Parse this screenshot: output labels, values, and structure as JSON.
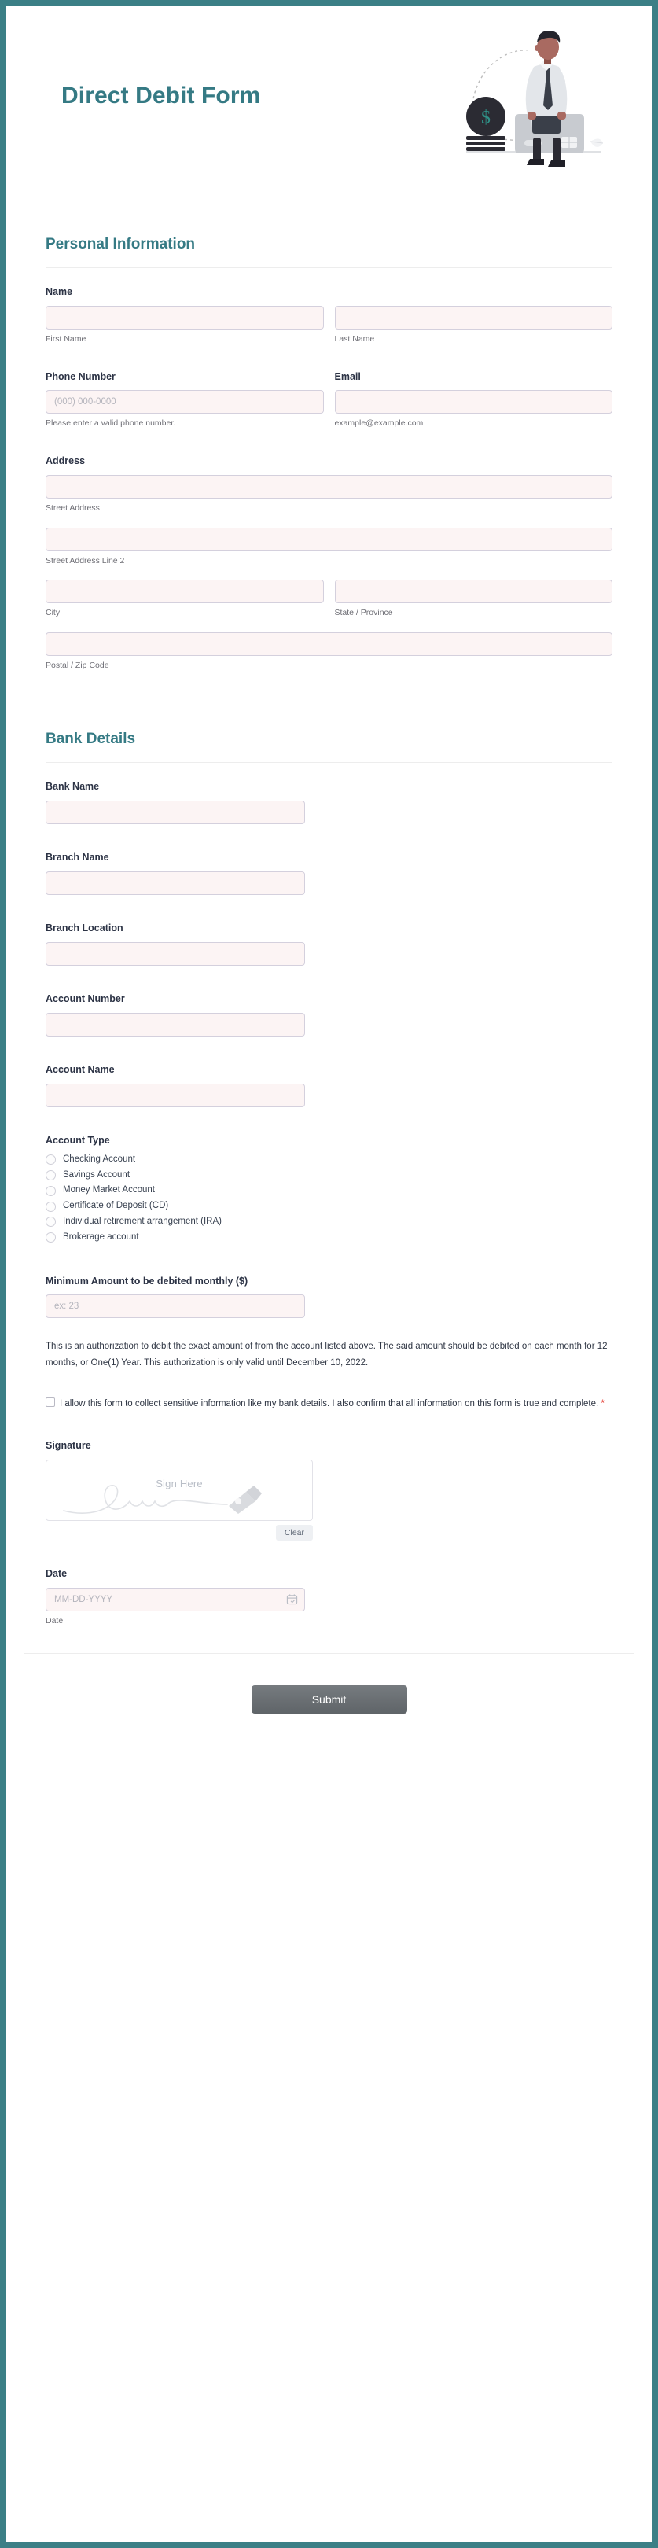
{
  "page": {
    "border_color": "#3b7f86",
    "accent_color": "#357a84",
    "input_bg": "#fcf4f4",
    "required_color": "#e1251b"
  },
  "header": {
    "title": "Direct Debit Form",
    "illustration": "person-with-credit-card-and-coins-illustration"
  },
  "personal": {
    "section_title": "Personal Information",
    "name": {
      "label": "Name",
      "first": {
        "value": "",
        "placeholder": "",
        "sub": "First Name"
      },
      "last": {
        "value": "",
        "placeholder": "",
        "sub": "Last Name"
      }
    },
    "phone": {
      "label": "Phone Number",
      "placeholder": "(000) 000-0000",
      "value": "",
      "sub": "Please enter a valid phone number."
    },
    "email": {
      "label": "Email",
      "placeholder": "",
      "value": "",
      "sub": "example@example.com"
    },
    "address": {
      "label": "Address",
      "street1": {
        "value": "",
        "sub": "Street Address"
      },
      "street2": {
        "value": "",
        "sub": "Street Address Line 2"
      },
      "city": {
        "value": "",
        "sub": "City"
      },
      "state": {
        "value": "",
        "sub": "State / Province"
      },
      "zip": {
        "value": "",
        "sub": "Postal / Zip Code"
      }
    }
  },
  "bank": {
    "section_title": "Bank Details",
    "bank_name": {
      "label": "Bank Name",
      "value": ""
    },
    "branch_name": {
      "label": "Branch Name",
      "value": ""
    },
    "branch_location": {
      "label": "Branch Location",
      "value": ""
    },
    "account_number": {
      "label": "Account Number",
      "value": ""
    },
    "account_name": {
      "label": "Account Name",
      "value": ""
    },
    "account_type": {
      "label": "Account Type",
      "options": [
        "Checking Account",
        "Savings Account",
        "Money Market Account",
        "Certificate of Deposit (CD)",
        "Individual retirement arrangement (IRA)",
        "Brokerage account"
      ],
      "selected": ""
    },
    "minimum_amount": {
      "label": "Minimum Amount to be debited monthly ($)",
      "placeholder": "ex: 23",
      "value": ""
    }
  },
  "authorization": {
    "text": "This is an authorization to debit the exact amount of from the account listed above. The said amount should be debited on each month for 12 months, or One(1) Year. This authorization is only valid until December 10, 2022."
  },
  "consent": {
    "text": "I allow this form to collect sensitive information like my bank details. I also confirm that all information on this form is true and complete.",
    "required_mark": "*",
    "checked": false
  },
  "signature": {
    "label": "Signature",
    "hint": "Sign Here",
    "clear_label": "Clear"
  },
  "date": {
    "label": "Date",
    "placeholder": "MM-DD-YYYY",
    "value": "",
    "sub": "Date",
    "icon": "calendar-icon"
  },
  "footer": {
    "submit_label": "Submit"
  }
}
